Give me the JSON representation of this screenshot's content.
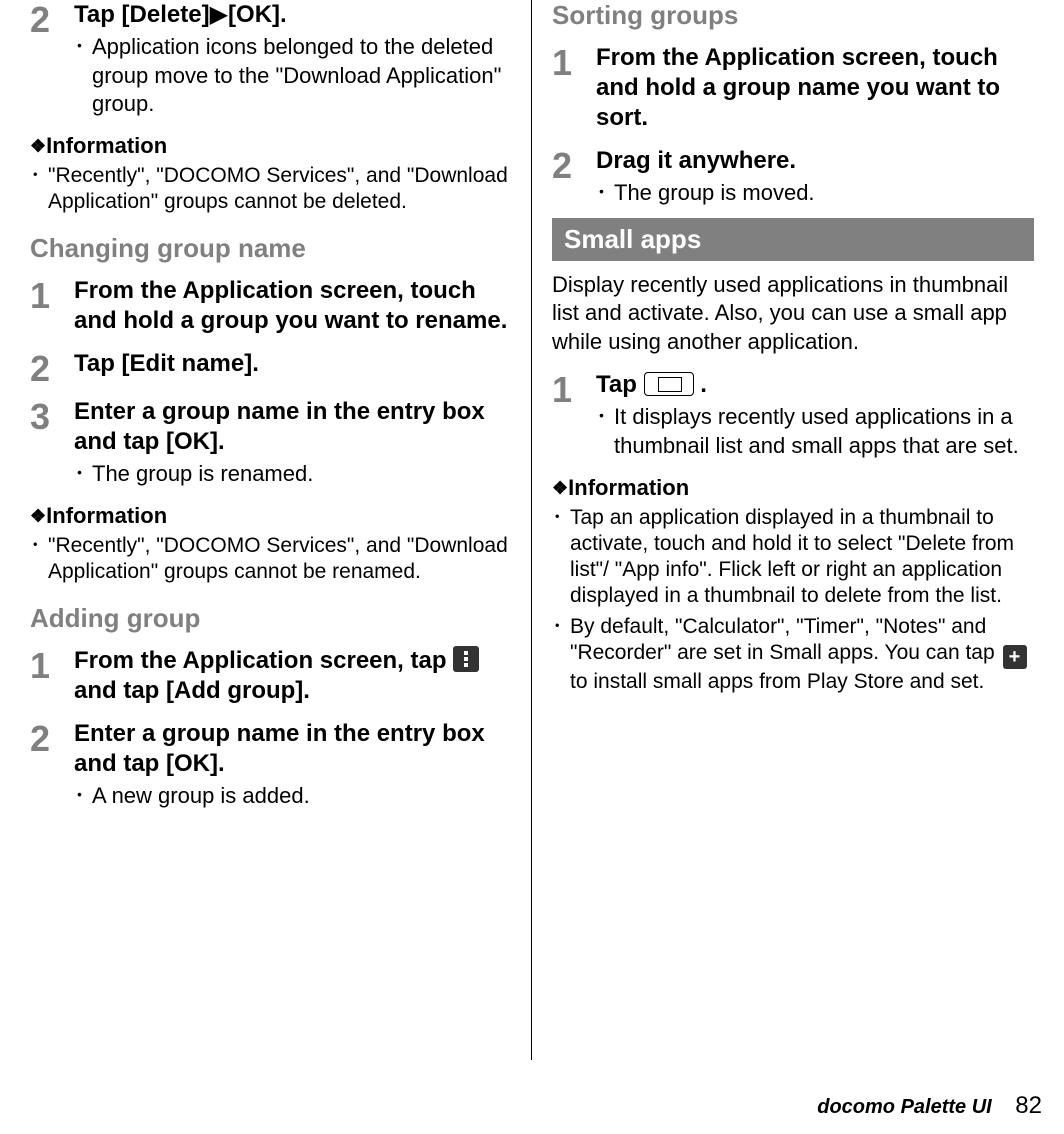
{
  "left": {
    "step2a": {
      "num": "2",
      "title_pre": "Tap [Delete]",
      "title_post": "[OK].",
      "detail": "Application icons belonged to the deleted group move to the \"Download Application\" group."
    },
    "info1": {
      "head": "Information",
      "item1": "\"Recently\", \"DOCOMO Services\", and \"Download Application\" groups cannot be deleted."
    },
    "h_change": "Changing group name",
    "change_s1": {
      "num": "1",
      "title": "From the Application screen, touch and hold a group you want to rename."
    },
    "change_s2": {
      "num": "2",
      "title": "Tap [Edit name]."
    },
    "change_s3": {
      "num": "3",
      "title": "Enter a group name in the entry box and tap [OK].",
      "detail": "The group is renamed."
    },
    "info2": {
      "head": "Information",
      "item1": "\"Recently\", \"DOCOMO Services\", and \"Download Application\" groups cannot be renamed."
    },
    "h_add": "Adding group",
    "add_s1": {
      "num": "1",
      "title_pre": "From the Application screen, tap ",
      "title_post": " and tap [Add group]."
    },
    "add_s2": {
      "num": "2",
      "title": "Enter a group name in the entry box and tap [OK].",
      "detail": "A new group is added."
    }
  },
  "right": {
    "h_sort": "Sorting groups",
    "sort_s1": {
      "num": "1",
      "title": "From the Application screen, touch and hold a group name you want to sort."
    },
    "sort_s2": {
      "num": "2",
      "title": "Drag it anywhere.",
      "detail": "The group is moved."
    },
    "box_small": "Small apps",
    "intro": "Display recently used applications in thumbnail list and activate. Also, you can use a small app while using another application.",
    "small_s1": {
      "num": "1",
      "title_pre": "Tap ",
      "title_post": ".",
      "detail": "It displays recently used applications in a thumbnail list and small apps that are set."
    },
    "info3": {
      "head": "Information",
      "item1": "Tap an application displayed in a thumbnail to activate, touch and hold it to select \"Delete from list\"/ \"App info\". Flick left or right an application displayed in a thumbnail to delete from the list.",
      "item2a": "By default, \"Calculator\", \"Timer\", \"Notes\" and \"Recorder\" are set in Small apps. You can tap ",
      "item2b": " to install small apps from Play Store and set."
    }
  },
  "footer": {
    "title": "docomo Palette UI",
    "page": "82"
  }
}
